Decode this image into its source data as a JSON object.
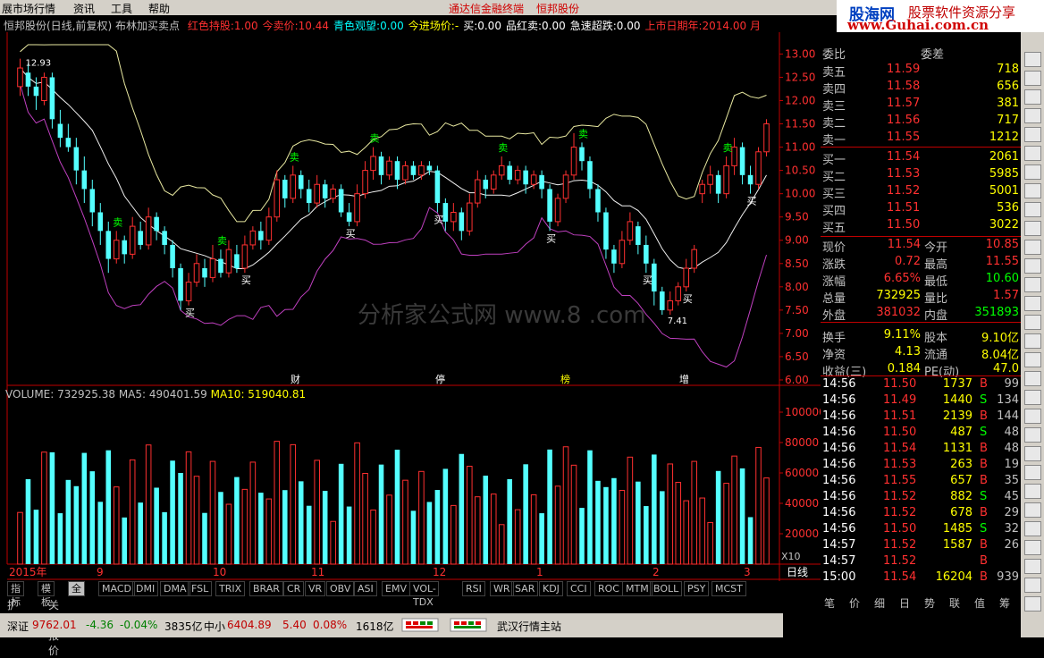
{
  "menu": {
    "items": [
      "展市场行情",
      "资讯",
      "工具",
      "帮助"
    ],
    "center_title": [
      "通达信金融终端",
      "恒邦股份"
    ]
  },
  "logo": {
    "brand": "股海网",
    "slogan": "股票软件资源分享",
    "url": "www.Guhai.com.cn"
  },
  "info_line": {
    "stock": "恒邦股份(日线,前复权)",
    "indicator": "布林加买卖点",
    "fields": [
      {
        "label": "红色持股:",
        "value": "1.00",
        "color": "#ff3030"
      },
      {
        "label": "今卖价:",
        "value": "10.44",
        "color": "#ff3030"
      },
      {
        "label": "青色观望:",
        "value": "0.00",
        "color": "#00ffff"
      },
      {
        "label": "今进场价:",
        "value": "-",
        "color": "#ffff00"
      },
      {
        "label": "买:",
        "value": "0.00",
        "color": "#ffffff"
      },
      {
        "label": "品红卖:",
        "value": "0.00",
        "color": "#ffffff"
      },
      {
        "label": "急速超跌:",
        "value": "0.00",
        "color": "#ffffff"
      },
      {
        "label": "上市日期年:",
        "value": "2014.00",
        "color": "#ff3030"
      }
    ],
    "tail": "月"
  },
  "price_axis": [
    "13.00",
    "12.50",
    "12.00",
    "11.50",
    "11.00",
    "10.50",
    "10.00",
    "9.50",
    "9.00",
    "8.50",
    "8.00",
    "7.50",
    "7.00",
    "6.50",
    "6.00"
  ],
  "annotations": {
    "high": "12.93",
    "low": "7.41"
  },
  "event_markers": [
    "财",
    "停",
    "榜",
    "增"
  ],
  "volume_legend": {
    "volume": "VOLUME: 732925.38",
    "ma5": "MA5: 490401.59",
    "ma10": "MA10: 519040.81"
  },
  "volume_axis": [
    "100000",
    "80000",
    "60000",
    "40000",
    "20000"
  ],
  "volume_unit": "X10",
  "date_axis": [
    "2015年",
    "9",
    "10",
    "11",
    "12",
    "1",
    "2",
    "3"
  ],
  "period": "日线",
  "period_buttons": [
    "+",
    "-",
    "0"
  ],
  "quotes": {
    "commission_label": "委比",
    "commission_diff_label": "委差",
    "sell": [
      {
        "label": "卖五",
        "price": "11.59",
        "vol": "718"
      },
      {
        "label": "卖四",
        "price": "11.58",
        "vol": "656"
      },
      {
        "label": "卖三",
        "price": "11.57",
        "vol": "381"
      },
      {
        "label": "卖二",
        "price": "11.56",
        "vol": "717"
      },
      {
        "label": "卖一",
        "price": "11.55",
        "vol": "1212"
      }
    ],
    "buy": [
      {
        "label": "买一",
        "price": "11.54",
        "vol": "2061"
      },
      {
        "label": "买二",
        "price": "11.53",
        "vol": "5985"
      },
      {
        "label": "买三",
        "price": "11.52",
        "vol": "5001"
      },
      {
        "label": "买四",
        "price": "11.51",
        "vol": "536"
      },
      {
        "label": "买五",
        "price": "11.50",
        "vol": "3022"
      }
    ],
    "stats": [
      {
        "l1": "现价",
        "v1": "11.54",
        "c1": "#ff3030",
        "l2": "今开",
        "v2": "10.85",
        "c2": "#ff3030"
      },
      {
        "l1": "涨跌",
        "v1": "0.72",
        "c1": "#ff3030",
        "l2": "最高",
        "v2": "11.55",
        "c2": "#ff3030"
      },
      {
        "l1": "涨幅",
        "v1": "6.65%",
        "c1": "#ff3030",
        "l2": "最低",
        "v2": "10.60",
        "c2": "#00ff00"
      },
      {
        "l1": "总量",
        "v1": "732925",
        "c1": "#ffff00",
        "l2": "量比",
        "v2": "1.57",
        "c2": "#ff3030"
      },
      {
        "l1": "外盘",
        "v1": "381032",
        "c1": "#ff3030",
        "l2": "内盘",
        "v2": "351893",
        "c2": "#00ff00"
      },
      {
        "l1": "换手",
        "v1": "9.11%",
        "c1": "#ffff00",
        "l2": "股本",
        "v2": "9.10亿",
        "c2": "#ffff00"
      },
      {
        "l1": "净资",
        "v1": "4.13",
        "c1": "#ffff00",
        "l2": "流通",
        "v2": "8.04亿",
        "c2": "#ffff00"
      },
      {
        "l1": "收益(三)",
        "v1": "0.184",
        "c1": "#ffff00",
        "l2": "PE(动)",
        "v2": "47.0",
        "c2": "#ffff00"
      }
    ]
  },
  "ticks": [
    {
      "time": "14:56",
      "price": "11.50",
      "vol": "1737",
      "side": "B",
      "n": "99"
    },
    {
      "time": "14:56",
      "price": "11.49",
      "vol": "1440",
      "side": "S",
      "n": "134"
    },
    {
      "time": "14:56",
      "price": "11.51",
      "vol": "2139",
      "side": "B",
      "n": "144"
    },
    {
      "time": "14:56",
      "price": "11.50",
      "vol": "487",
      "side": "S",
      "n": "48"
    },
    {
      "time": "14:56",
      "price": "11.54",
      "vol": "1131",
      "side": "B",
      "n": "48"
    },
    {
      "time": "14:56",
      "price": "11.53",
      "vol": "263",
      "side": "B",
      "n": "19"
    },
    {
      "time": "14:56",
      "price": "11.55",
      "vol": "657",
      "side": "B",
      "n": "35"
    },
    {
      "time": "14:56",
      "price": "11.52",
      "vol": "882",
      "side": "S",
      "n": "45"
    },
    {
      "time": "14:56",
      "price": "11.52",
      "vol": "678",
      "side": "B",
      "n": "29"
    },
    {
      "time": "14:56",
      "price": "11.50",
      "vol": "1485",
      "side": "S",
      "n": "32"
    },
    {
      "time": "14:57",
      "price": "11.52",
      "vol": "1587",
      "side": "B",
      "n": "26"
    },
    {
      "time": "14:57",
      "price": "11.52",
      "vol": "",
      "side": "B",
      "n": ""
    },
    {
      "time": "15:00",
      "price": "11.54",
      "vol": "16204",
      "side": "B",
      "n": "939"
    }
  ],
  "bottom_tabs": [
    "笔",
    "价",
    "细",
    "日",
    "势",
    "联",
    "值",
    "筹"
  ],
  "indicator_tabs": [
    "指标",
    "模板",
    "全部",
    "MACD",
    "DMI",
    "DMA",
    "FSL",
    "TRIX",
    "BRAR",
    "CR",
    "VR",
    "OBV",
    "ASI",
    "EMV",
    "VOL-TDX",
    "RSI",
    "WR",
    "SAR",
    "KDJ",
    "CCI",
    "ROC",
    "MTM",
    "BOLL",
    "PSY",
    "MCST"
  ],
  "ext_tabs": [
    "扩展∧",
    "关联报价"
  ],
  "status": {
    "index_name": "深证",
    "index_value": "9762.01",
    "index_change": "-4.36",
    "index_pct": "-0.04%",
    "index_amount": "3835亿",
    "sub_name": "中小",
    "sub_value": "6404.89",
    "sub_change": "5.40",
    "sub_pct": "0.08%",
    "sub_amount": "1618亿",
    "server": "武汉行情主站"
  },
  "watermark": "分析家公式网 www.8                 .com",
  "chart_data": {
    "type": "candlestick",
    "ylim": [
      5.75,
      13.2
    ],
    "volume_ylim": [
      0,
      110000
    ],
    "candles_approx": [
      [
        12.3,
        12.7,
        12.9,
        12.1
      ],
      [
        12.6,
        12.3,
        12.8,
        12.1
      ],
      [
        12.3,
        12.1,
        12.5,
        11.8
      ],
      [
        12.0,
        12.5,
        12.6,
        11.9
      ],
      [
        12.5,
        11.6,
        12.6,
        11.4
      ],
      [
        11.5,
        11.2,
        11.8,
        11.0
      ],
      [
        11.2,
        11.0,
        11.5,
        10.9
      ],
      [
        11.0,
        10.5,
        11.2,
        10.2
      ],
      [
        10.5,
        10.1,
        10.8,
        9.8
      ],
      [
        10.1,
        9.6,
        10.3,
        9.3
      ],
      [
        9.6,
        9.2,
        9.8,
        8.9
      ],
      [
        9.2,
        8.6,
        9.4,
        8.3
      ],
      [
        8.6,
        9.0,
        9.2,
        8.5
      ],
      [
        9.0,
        8.7,
        9.1,
        8.5
      ],
      [
        8.7,
        9.3,
        9.5,
        8.6
      ],
      [
        9.2,
        8.9,
        9.4,
        8.8
      ],
      [
        8.9,
        9.5,
        9.7,
        8.8
      ],
      [
        9.5,
        9.2,
        9.6,
        9.0
      ],
      [
        9.2,
        8.9,
        9.3,
        8.7
      ],
      [
        8.9,
        8.4,
        9.0,
        8.2
      ],
      [
        8.4,
        7.7,
        8.5,
        7.5
      ],
      [
        7.7,
        8.1,
        8.3,
        7.6
      ],
      [
        8.1,
        8.5,
        8.7,
        8.0
      ],
      [
        8.4,
        8.2,
        8.6,
        8.0
      ],
      [
        8.2,
        8.6,
        8.9,
        8.1
      ],
      [
        8.6,
        8.3,
        8.8,
        8.2
      ],
      [
        8.3,
        8.8,
        9.0,
        8.2
      ],
      [
        8.7,
        8.4,
        8.9,
        8.3
      ],
      [
        8.4,
        8.9,
        9.1,
        8.3
      ],
      [
        8.9,
        9.2,
        9.3,
        8.8
      ],
      [
        9.2,
        9.0,
        9.4,
        8.8
      ],
      [
        9.0,
        9.5,
        9.7,
        8.9
      ],
      [
        9.5,
        10.3,
        10.5,
        9.4
      ],
      [
        10.3,
        9.9,
        10.4,
        9.7
      ],
      [
        9.9,
        10.4,
        10.6,
        9.8
      ],
      [
        10.4,
        10.1,
        10.5,
        9.9
      ],
      [
        10.1,
        9.8,
        10.3,
        9.6
      ],
      [
        9.8,
        10.2,
        10.4,
        9.7
      ],
      [
        10.2,
        9.9,
        10.3,
        9.7
      ],
      [
        9.9,
        10.1,
        10.2,
        9.8
      ],
      [
        10.1,
        9.6,
        10.2,
        9.5
      ],
      [
        9.6,
        9.4,
        9.8,
        9.3
      ],
      [
        9.4,
        10.0,
        10.2,
        9.3
      ],
      [
        10.0,
        10.5,
        10.7,
        9.9
      ],
      [
        10.5,
        10.8,
        11.0,
        10.3
      ],
      [
        10.8,
        10.4,
        10.9,
        10.2
      ],
      [
        10.4,
        10.7,
        10.8,
        10.3
      ],
      [
        10.7,
        10.3,
        10.8,
        10.1
      ],
      [
        10.3,
        10.6,
        10.7,
        10.2
      ],
      [
        10.6,
        10.4,
        10.7,
        10.3
      ],
      [
        10.4,
        10.6,
        10.7,
        10.3
      ],
      [
        10.6,
        10.5,
        10.7,
        10.4
      ],
      [
        10.5,
        9.8,
        10.6,
        9.6
      ],
      [
        9.8,
        9.4,
        9.9,
        9.2
      ],
      [
        9.4,
        9.6,
        9.8,
        9.2
      ],
      [
        9.6,
        9.2,
        9.7,
        9.0
      ],
      [
        9.2,
        9.8,
        10.0,
        9.1
      ],
      [
        9.8,
        10.3,
        10.5,
        9.7
      ],
      [
        10.3,
        10.1,
        10.4,
        9.9
      ],
      [
        10.1,
        10.4,
        10.5,
        10.0
      ],
      [
        10.4,
        10.6,
        10.8,
        10.3
      ],
      [
        10.6,
        10.3,
        10.7,
        10.2
      ],
      [
        10.3,
        10.5,
        10.6,
        10.2
      ],
      [
        10.5,
        10.2,
        10.6,
        10.0
      ],
      [
        10.2,
        10.4,
        10.5,
        10.1
      ],
      [
        10.4,
        10.1,
        10.5,
        9.9
      ],
      [
        10.1,
        9.4,
        10.2,
        9.2
      ],
      [
        9.4,
        9.9,
        10.0,
        9.3
      ],
      [
        9.9,
        10.4,
        10.5,
        9.8
      ],
      [
        10.4,
        11.0,
        11.3,
        10.3
      ],
      [
        11.0,
        10.7,
        11.1,
        10.5
      ],
      [
        10.7,
        10.1,
        10.8,
        9.9
      ],
      [
        10.1,
        9.6,
        10.2,
        9.4
      ],
      [
        9.6,
        8.8,
        9.7,
        8.6
      ],
      [
        8.8,
        8.5,
        8.9,
        8.3
      ],
      [
        8.5,
        9.0,
        9.2,
        8.4
      ],
      [
        9.0,
        9.4,
        9.6,
        8.9
      ],
      [
        9.3,
        8.9,
        9.4,
        8.7
      ],
      [
        8.9,
        8.5,
        9.1,
        8.3
      ],
      [
        8.5,
        7.9,
        8.6,
        7.6
      ],
      [
        7.9,
        7.5,
        8.0,
        7.4
      ],
      [
        7.5,
        7.7,
        7.9,
        7.4
      ],
      [
        7.7,
        8.0,
        8.1,
        7.6
      ],
      [
        8.0,
        8.4,
        8.6,
        7.9
      ],
      [
        8.4,
        8.8,
        8.9,
        8.3
      ],
      [
        10.0,
        10.2,
        10.3,
        9.8
      ],
      [
        10.2,
        10.4,
        10.6,
        10.0
      ],
      [
        10.4,
        10.0,
        10.5,
        9.8
      ],
      [
        10.0,
        10.6,
        10.8,
        9.9
      ],
      [
        10.6,
        11.0,
        11.2,
        10.4
      ],
      [
        11.0,
        10.4,
        11.1,
        10.2
      ],
      [
        10.4,
        10.2,
        10.6,
        10.0
      ],
      [
        10.2,
        10.9,
        11.0,
        10.1
      ],
      [
        10.9,
        11.5,
        11.6,
        10.8
      ]
    ]
  }
}
